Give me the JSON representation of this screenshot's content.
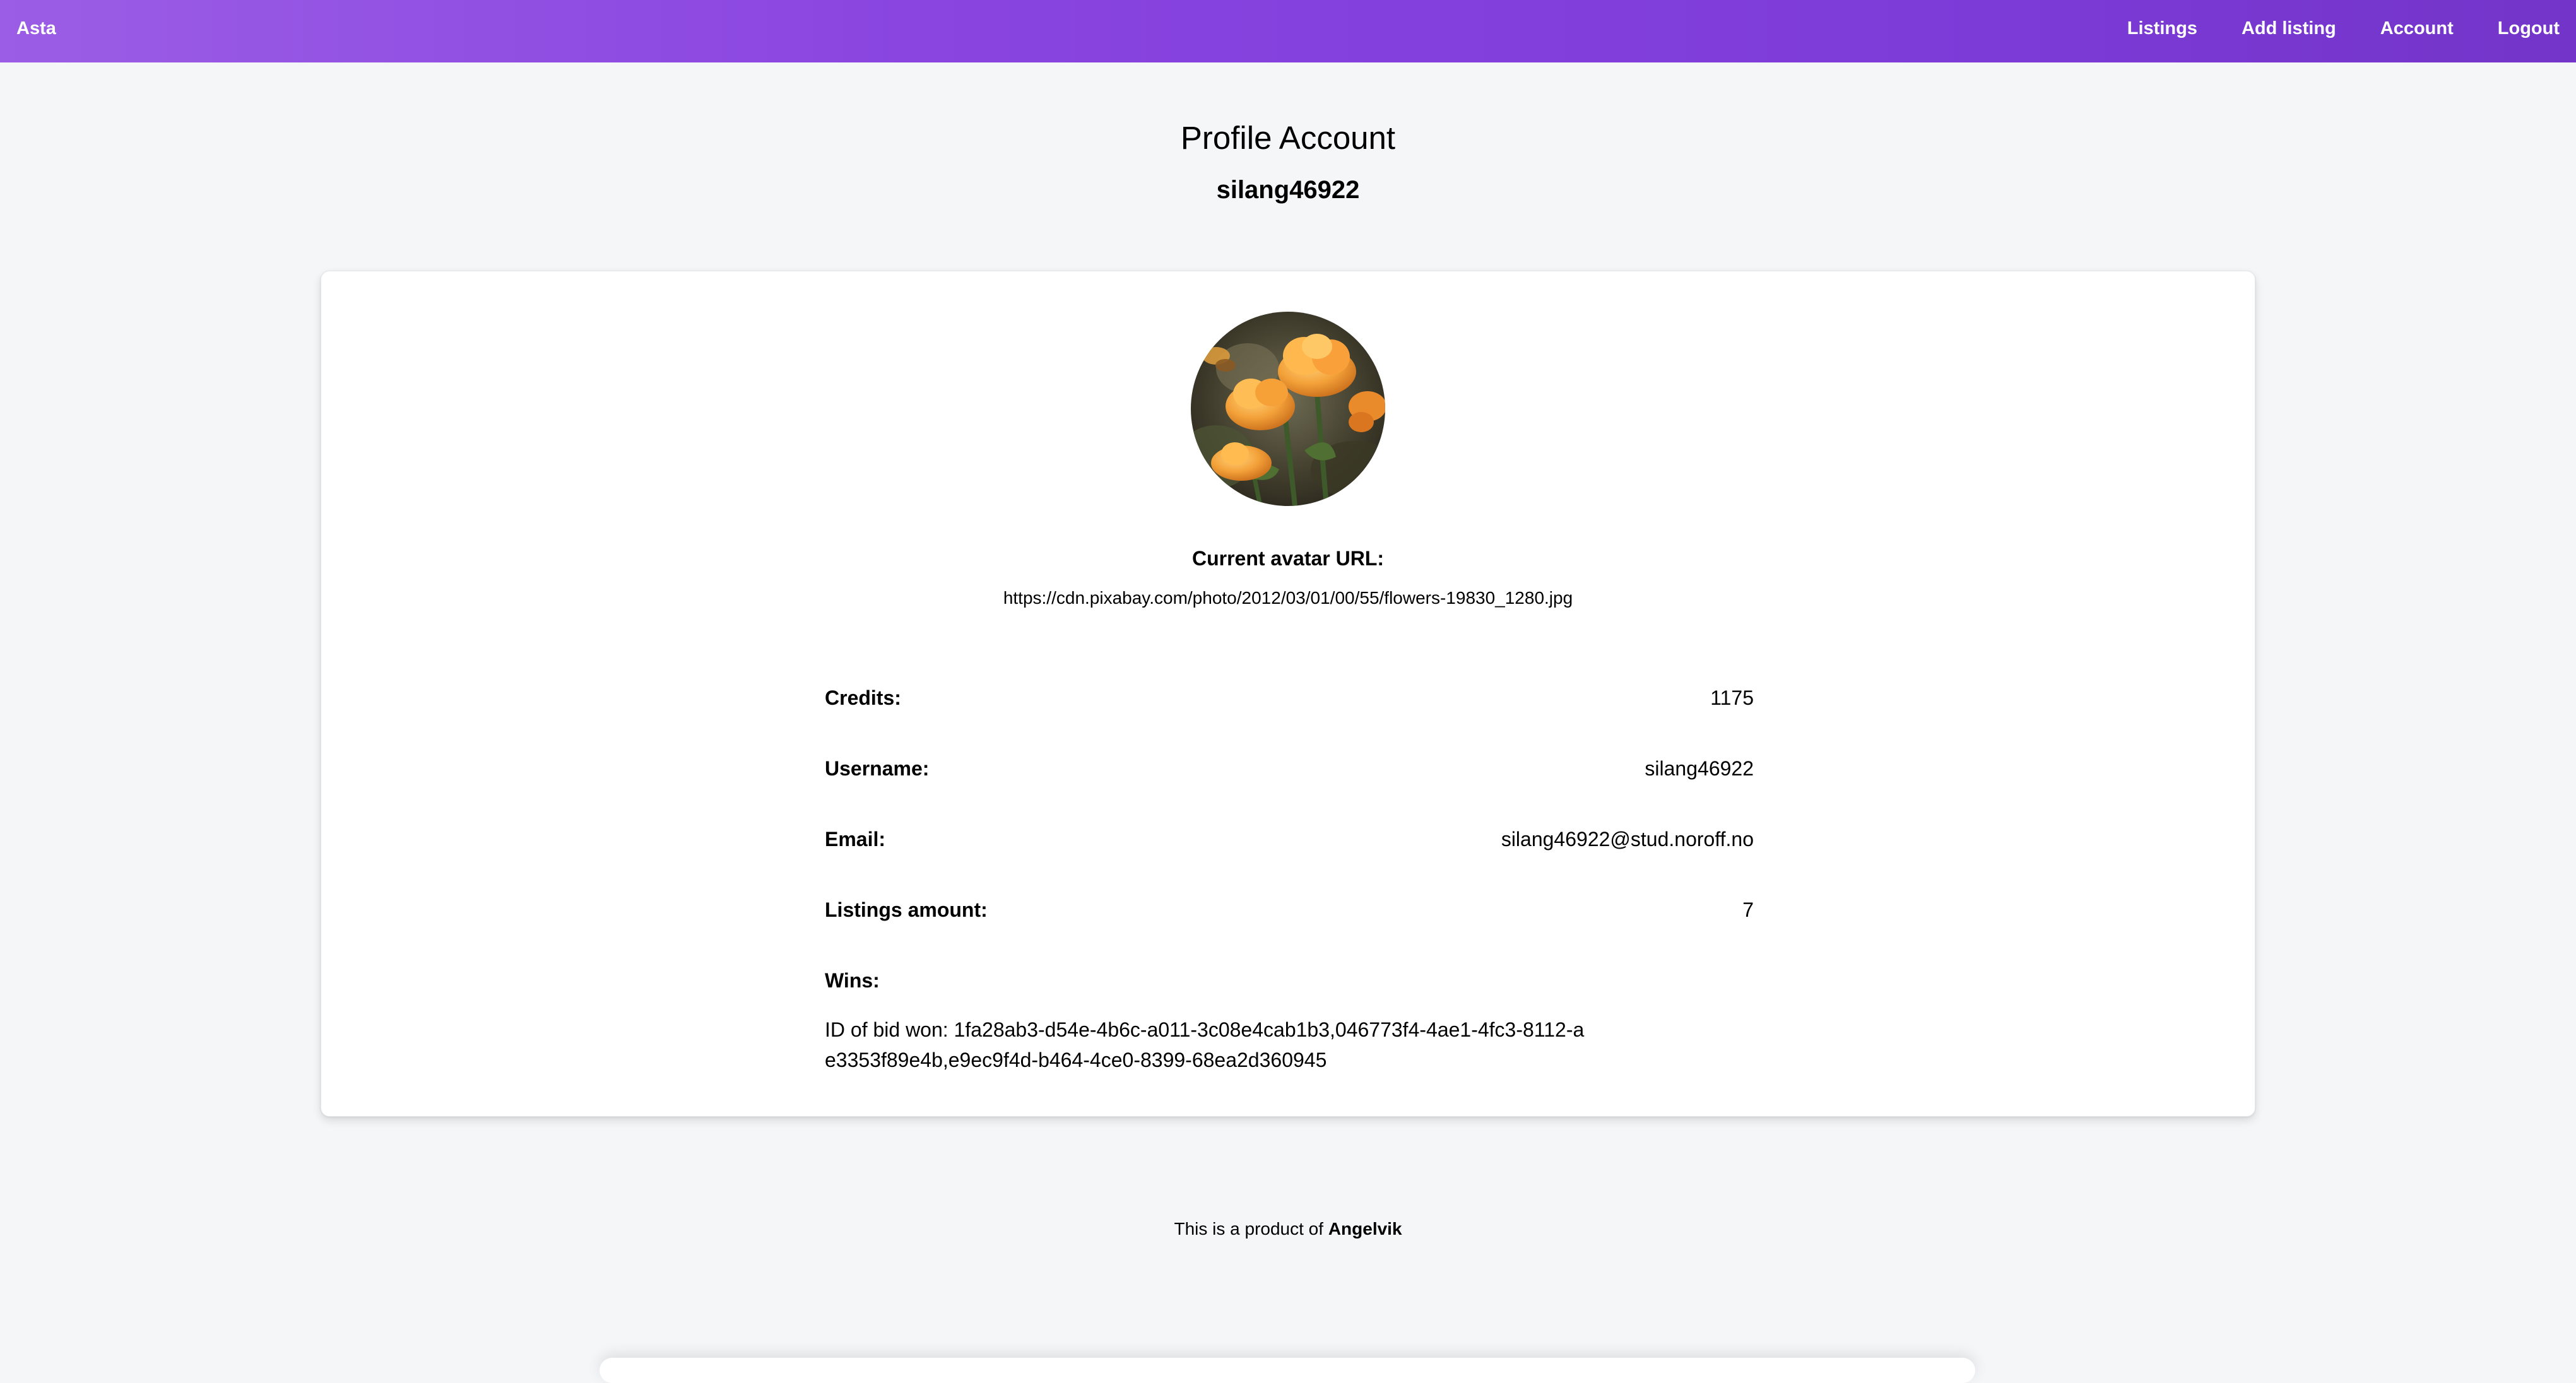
{
  "navbar": {
    "brand": "Asta",
    "links": [
      "Listings",
      "Add listing",
      "Account",
      "Logout"
    ]
  },
  "header": {
    "title": "Profile Account",
    "username": "silang46922"
  },
  "profile": {
    "avatar_label": "Current avatar URL:",
    "avatar_url": "https://cdn.pixabay.com/photo/2012/03/01/00/55/flowers-19830_1280.jpg",
    "details": [
      {
        "label": "Credits:",
        "value": "1175"
      },
      {
        "label": "Username:",
        "value": "silang46922"
      },
      {
        "label": "Email:",
        "value": "silang46922@stud.noroff.no"
      },
      {
        "label": "Listings amount:",
        "value": "7"
      }
    ],
    "wins_label": "Wins:",
    "wins_text": "ID of bid won: 1fa28ab3-d54e-4b6c-a011-3c08e4cab1b3,046773f4-4ae1-4fc3-8112-ae3353f89e4b,e9ec9f4d-b464-4ce0-8399-68ea2d360945"
  },
  "footer": {
    "prefix": "This is a product of",
    "brand": "Angelvik"
  },
  "colors": {
    "navbar_start": "#9b5de5",
    "navbar_end": "#7335c9",
    "page_background": "#f5f6f8",
    "card_background": "#ffffff"
  }
}
